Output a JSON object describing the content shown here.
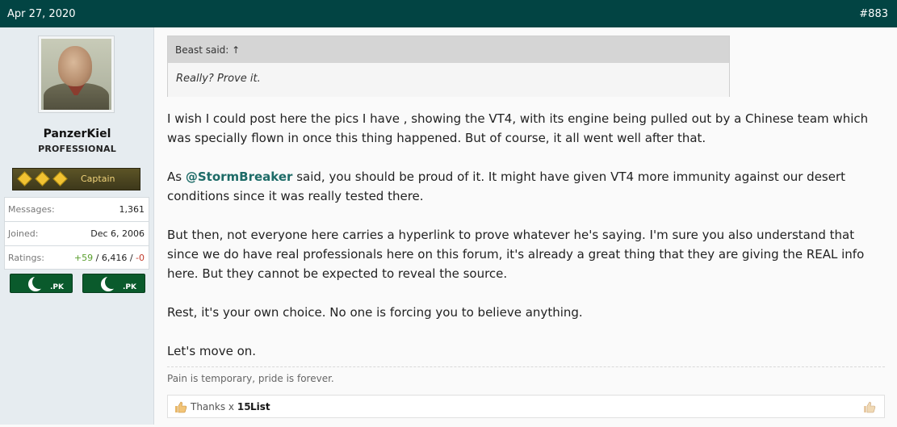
{
  "header": {
    "date": "Apr 27, 2020",
    "post_number": "#883"
  },
  "user": {
    "name": "PanzerKiel",
    "title": "PROFESSIONAL",
    "rank_label": "Captain",
    "stats": [
      {
        "key": "Messages:",
        "value": "1,361"
      },
      {
        "key": "Joined:",
        "value": "Dec 6, 2006"
      }
    ],
    "ratings": {
      "key": "Ratings:",
      "positive": "+59",
      "neutral": "6,416",
      "negative": "-0",
      "sep": " / "
    },
    "flags": [
      {
        "label": ".PK"
      },
      {
        "label": ".PK"
      }
    ]
  },
  "quote": {
    "author": "Beast said:",
    "arrow": "↑",
    "text": "Really? Prove it."
  },
  "message": {
    "p1": "I wish I could post here the pics I have , showing the VT4, with its engine being pulled out by a Chinese team which was specially flown in once this thing happened. But of course, it all went well after that.",
    "p2_before": "As ",
    "p2_mention": "@StormBreaker",
    "p2_after": " said, you should be proud of it. It might have given VT4 more immunity against our desert conditions since it was really tested there.",
    "p3": "But then, not everyone here carries a hyperlink to prove whatever he's saying. I'm sure you also understand that since we do have real professionals here on this forum, it's already a great thing that they are giving the REAL info here. But they cannot be expected to reveal the source.",
    "p4": "Rest, it's your own choice. No one is forcing you to believe anything.",
    "p5": "Let's move on."
  },
  "signature": "Pain is temporary, pride is forever.",
  "reactions": {
    "thanks_label": "Thanks x",
    "thanks_count": "15",
    "list_label": "List"
  },
  "colors": {
    "header_bg": "#024443",
    "mention": "#1d6b67",
    "positive": "#5a9f2e",
    "negative": "#c23b2b"
  }
}
